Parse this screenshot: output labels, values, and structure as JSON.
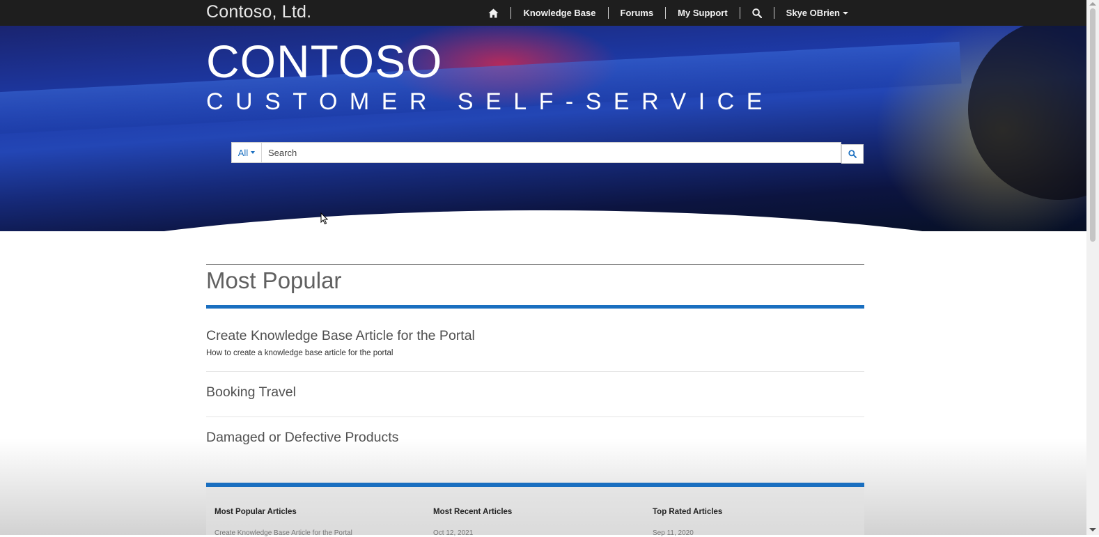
{
  "brand": "Contoso, Ltd.",
  "nav": {
    "home_icon": "home-icon",
    "knowledge_base": "Knowledge Base",
    "forums": "Forums",
    "my_support": "My Support",
    "search_icon": "search-icon",
    "user": "Skye OBrien"
  },
  "hero": {
    "title": "CONTOSO",
    "subtitle": "CUSTOMER SELF-SERVICE"
  },
  "search": {
    "scope": "All",
    "placeholder": "Search"
  },
  "most_popular": {
    "title": "Most Popular",
    "articles": [
      {
        "title": "Create Knowledge Base Article for the Portal",
        "description": "How to create a knowledge base article for the portal"
      },
      {
        "title": "Booking Travel",
        "description": ""
      },
      {
        "title": "Damaged or Defective Products",
        "description": ""
      }
    ]
  },
  "footer": {
    "columns": [
      {
        "heading": "Most Popular Articles",
        "first": "Create Knowledge Base Article for the Portal"
      },
      {
        "heading": "Most Recent Articles",
        "first": "Oct 12, 2021"
      },
      {
        "heading": "Top Rated Articles",
        "first": "Sep 11, 2020"
      }
    ]
  },
  "colors": {
    "nav_bg": "#1e1e1e",
    "accent": "#1a6fc0"
  }
}
